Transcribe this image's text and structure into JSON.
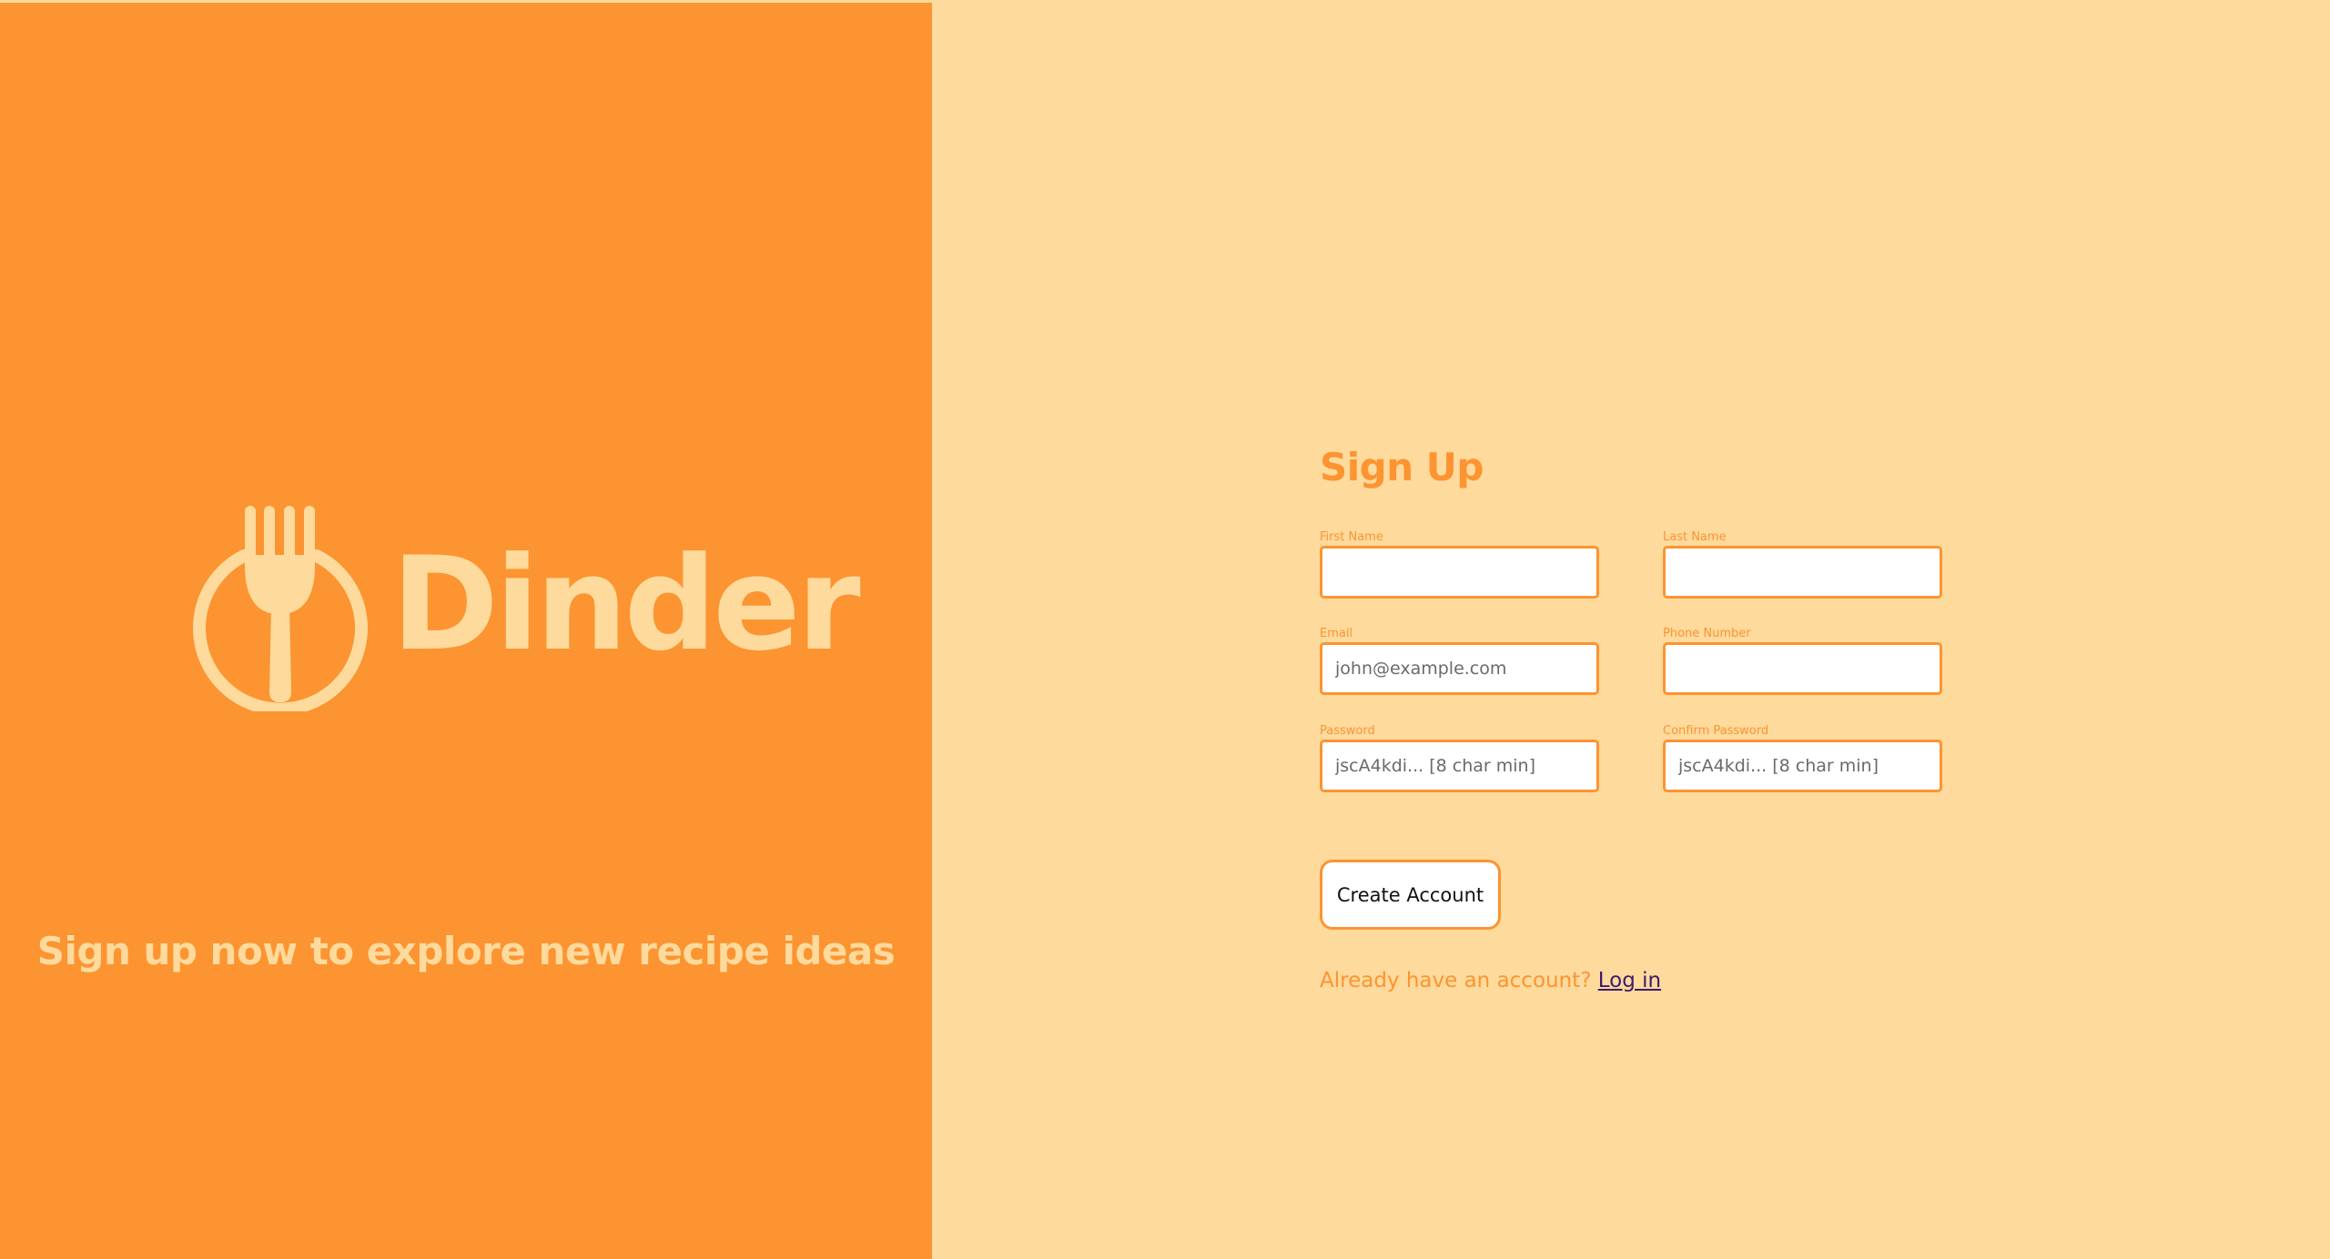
{
  "brand": {
    "name": "Dinder",
    "tagline": "Sign up now to explore new recipe ideas"
  },
  "form": {
    "title": "Sign Up",
    "fields": {
      "first_name": {
        "label": "First Name",
        "placeholder": "",
        "value": ""
      },
      "last_name": {
        "label": "Last Name",
        "placeholder": "",
        "value": ""
      },
      "email": {
        "label": "Email",
        "placeholder": "john@example.com",
        "value": ""
      },
      "phone": {
        "label": "Phone Number",
        "placeholder": "",
        "value": ""
      },
      "password": {
        "label": "Password",
        "placeholder": "jscA4kdi... [8 char min]",
        "value": ""
      },
      "confirm_password": {
        "label": "Confirm Password",
        "placeholder": "jscA4kdi... [8 char min]",
        "value": ""
      }
    },
    "submit_label": "Create Account",
    "login_prompt": "Already have an account?",
    "login_link": "Log in"
  },
  "colors": {
    "primary_orange": "#FC9431",
    "cream": "#FEDA9C",
    "link": "#3f1a6b"
  },
  "icons": {
    "logo": "fork-in-circle-icon"
  }
}
